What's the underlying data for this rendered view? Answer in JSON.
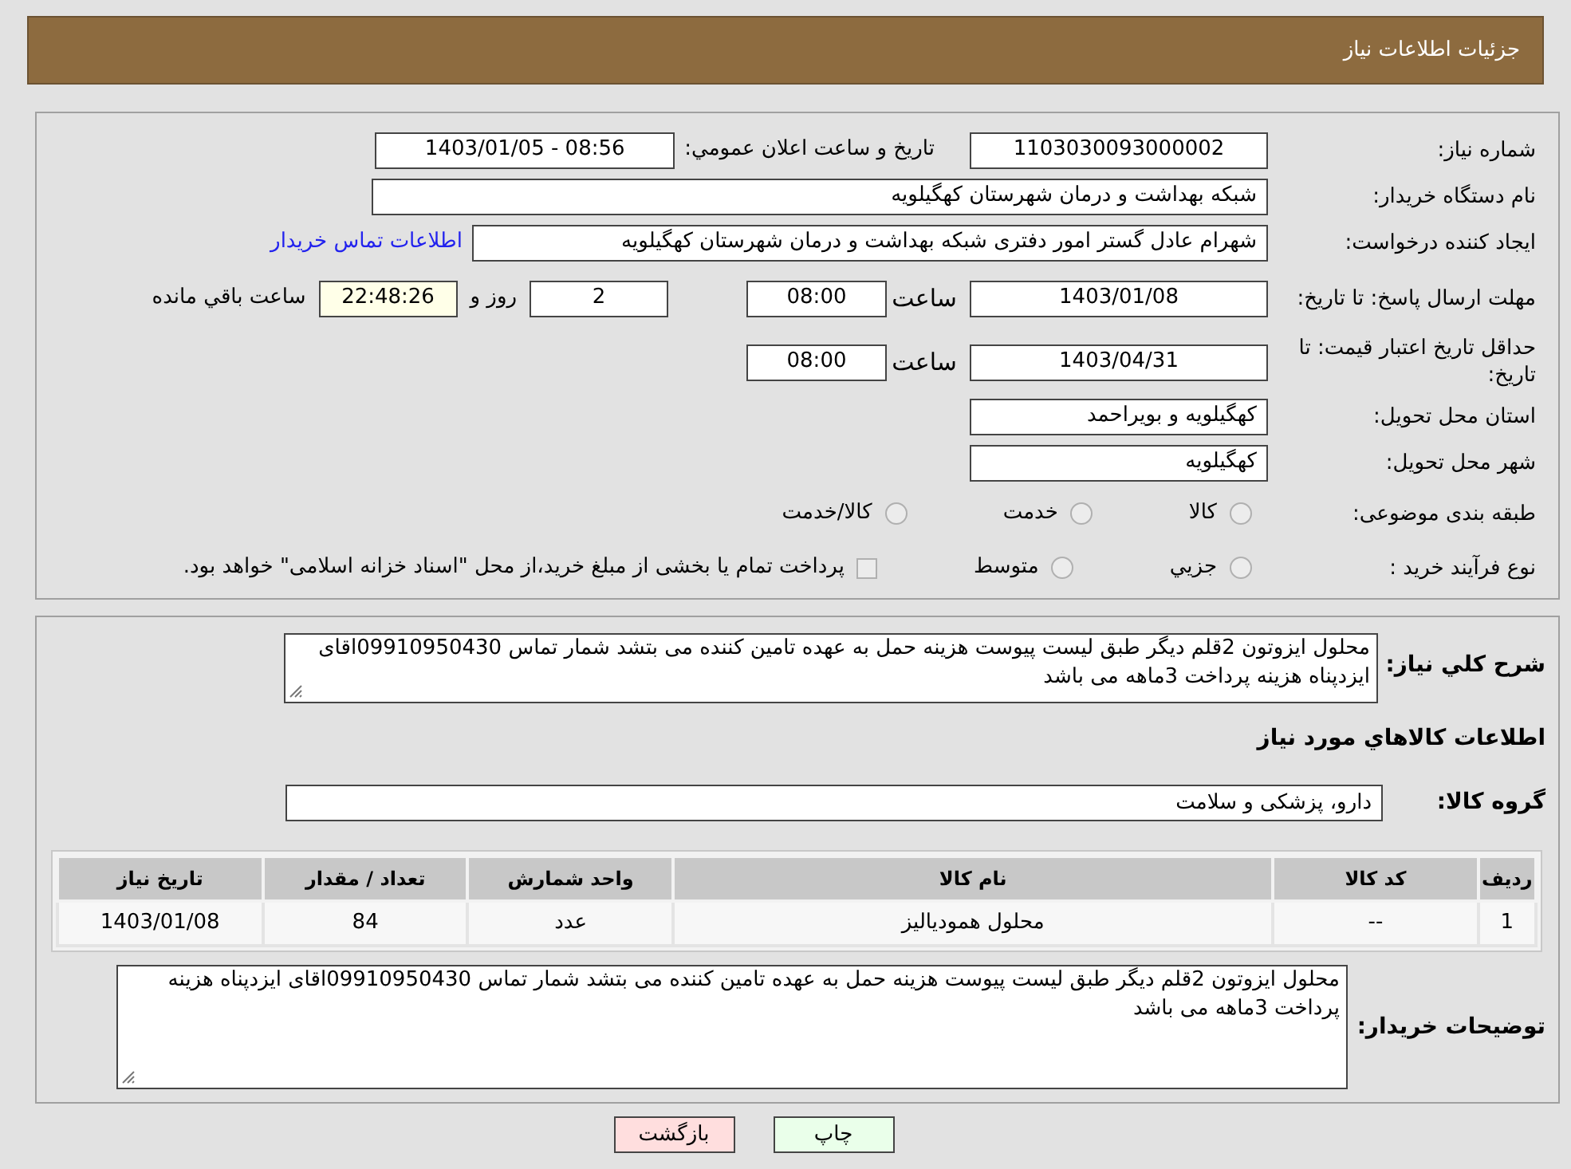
{
  "header": {
    "title": "جزئیات اطلاعات نیاز"
  },
  "need_number": {
    "label": "شماره نیاز:",
    "value": "1103030093000002"
  },
  "announce": {
    "label": "تاریخ و ساعت اعلان عمومي:",
    "value": "1403/01/05 - 08:56"
  },
  "buyer_org": {
    "label": "نام دستگاه خریدار:",
    "value": "شبکه بهداشت و درمان شهرستان کهگیلویه"
  },
  "requester": {
    "label": "ایجاد کننده درخواست:",
    "value": "شهرام عادل گستر امور دفتری شبکه بهداشت و درمان شهرستان کهگیلویه",
    "link": "اطلاعات تماس خریدار"
  },
  "reply_deadline": {
    "label": "مهلت ارسال پاسخ: تا تاریخ:",
    "date": "1403/01/08",
    "time_label": "ساعت",
    "time": "08:00",
    "days": "2",
    "days_label": "روز و",
    "remaining": "22:48:26",
    "remaining_label": "ساعت باقي مانده"
  },
  "price_validity": {
    "label": "حداقل تاریخ اعتبار قیمت: تا تاریخ:",
    "date": "1403/04/31",
    "time_label": "ساعت",
    "time": "08:00"
  },
  "province": {
    "label": "استان محل تحویل:",
    "value": "کهگیلویه و بویراحمد"
  },
  "city": {
    "label": "شهر محل تحویل:",
    "value": "کهگیلویه"
  },
  "category": {
    "label": "طبقه بندی موضوعی:",
    "options": [
      {
        "label": "کالا",
        "selected": false
      },
      {
        "label": "خدمت",
        "selected": false
      },
      {
        "label": "کالا/خدمت",
        "selected": false
      }
    ]
  },
  "purchase_type": {
    "label": "نوع فرآیند خرید :",
    "options": [
      {
        "label": "جزيي",
        "selected": false
      },
      {
        "label": "متوسط",
        "selected": false
      }
    ],
    "payment_note": {
      "text": "پرداخت تمام یا بخشی از مبلغ خرید،از محل \"اسناد خزانه اسلامی\" خواهد بود.",
      "checked": false
    }
  },
  "description": {
    "label": "شرح کلي نیاز:",
    "value": "محلول ایزوتون 2قلم دیگر طبق لیست پیوست هزینه حمل به عهده تامین کننده می بتشد شمار تماس 09910950430اقای ایزدپناه هزینه پرداخت 3ماهه می باشد"
  },
  "goods_heading": "اطلاعات کالاهاي مورد نیاز",
  "goods_group": {
    "label": "گروه کالا:",
    "value": "دارو، پزشکی و سلامت"
  },
  "table": {
    "columns": [
      "ردیف",
      "کد کالا",
      "نام کالا",
      "واحد شمارش",
      "تعداد / مقدار",
      "تاریخ نیاز"
    ],
    "rows": [
      [
        "1",
        "--",
        "محلول همودیالیز",
        "عدد",
        "84",
        "1403/01/08"
      ]
    ]
  },
  "buyer_notes": {
    "label": "توضیحات خریدار:",
    "value": "محلول ایزوتون 2قلم دیگر طبق لیست پیوست هزینه حمل به عهده تامین کننده می بتشد شمار تماس 09910950430اقای ایزدپناه هزینه پرداخت 3ماهه می باشد"
  },
  "buttons": [
    {
      "label": "چاپ",
      "kind": "print"
    },
    {
      "label": "بازگشت",
      "kind": "back"
    }
  ]
}
